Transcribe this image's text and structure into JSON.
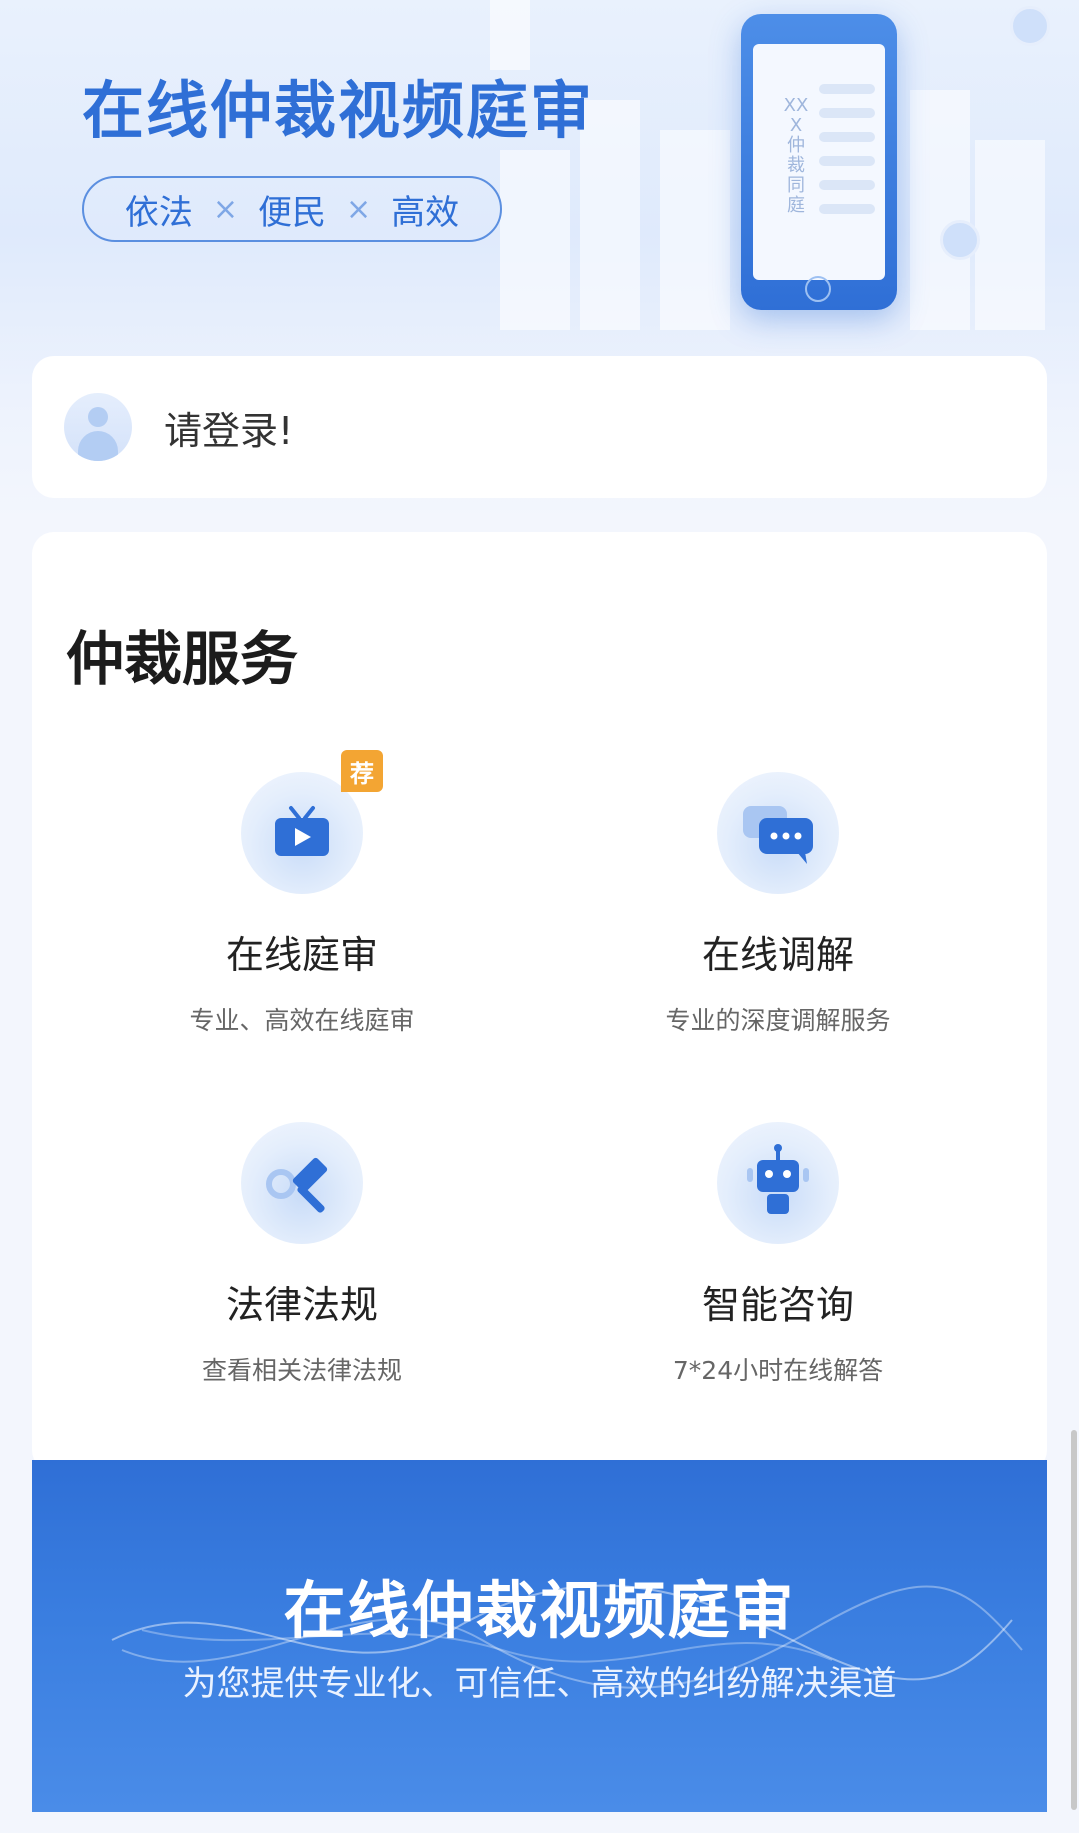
{
  "hero": {
    "title": "在线仲裁视频庭审",
    "tags": [
      "依法",
      "便民",
      "高效"
    ],
    "separator": "×",
    "phone_text": "XXX仲裁同庭"
  },
  "login": {
    "prompt": "请登录!"
  },
  "services": {
    "title": "仲裁服务",
    "items": [
      {
        "name": "在线庭审",
        "desc": "专业、高效在线庭审",
        "icon": "tv-play-icon",
        "badge": "荐"
      },
      {
        "name": "在线调解",
        "desc": "专业的深度调解服务",
        "icon": "chat-bubbles-icon"
      },
      {
        "name": "法律法规",
        "desc": "查看相关法律法规",
        "icon": "gavel-search-icon"
      },
      {
        "name": "智能咨询",
        "desc": "7*24小时在线解答",
        "icon": "robot-icon"
      }
    ]
  },
  "banner": {
    "title": "在线仲裁视频庭审",
    "subtitle": "为您提供专业化、可信任、高效的纠纷解决渠道"
  },
  "colors": {
    "primary": "#2f6fd6",
    "badge": "#f3a533",
    "background": "#f3f6fd"
  }
}
